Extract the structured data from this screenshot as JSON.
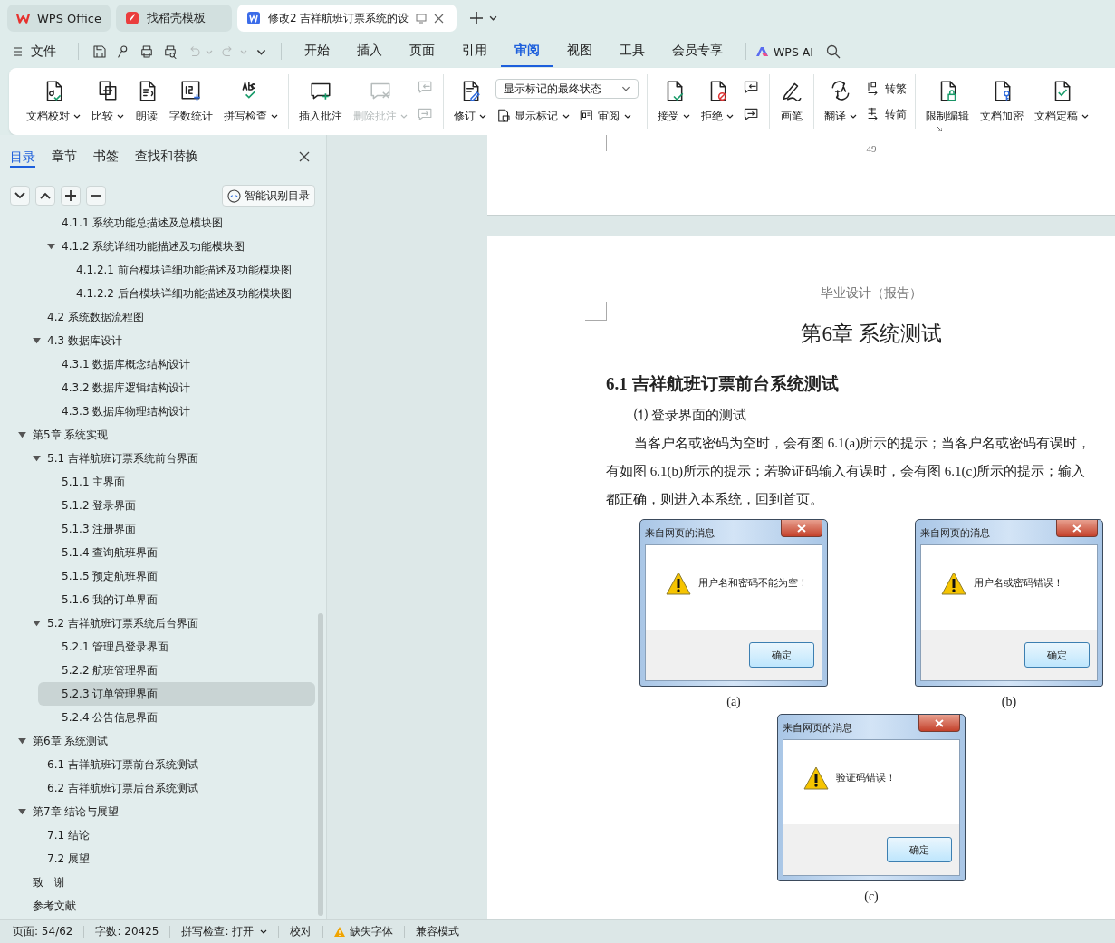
{
  "tabs": [
    {
      "label": "WPS Office",
      "selected": false
    },
    {
      "label": "找稻壳模板",
      "selected": false
    },
    {
      "label": "修改2 吉祥航班订票系统的设",
      "selected": true
    }
  ],
  "menu": {
    "file": "文件",
    "quick_access": [
      {
        "disabled": false
      },
      {
        "disabled": false
      },
      {
        "disabled": false
      },
      {
        "disabled": false
      },
      {
        "disabled": true
      },
      {
        "disabled": true
      }
    ],
    "tabs": [
      {
        "label": "开始",
        "selected": false
      },
      {
        "label": "插入",
        "selected": false
      },
      {
        "label": "页面",
        "selected": false
      },
      {
        "label": "引用",
        "selected": false
      },
      {
        "label": "审阅",
        "selected": true
      },
      {
        "label": "视图",
        "selected": false
      },
      {
        "label": "工具",
        "selected": false
      },
      {
        "label": "会员专享",
        "selected": false
      }
    ],
    "ai": "WPS AI"
  },
  "ribbon": {
    "groups": [
      {
        "items": [
          {
            "kind": "large",
            "label": "文档校对",
            "dropdown": true,
            "disabled": false
          },
          {
            "kind": "large",
            "label": "比较",
            "dropdown": true,
            "disabled": false
          },
          {
            "kind": "large",
            "label": "朗读",
            "dropdown": false,
            "disabled": false
          },
          {
            "kind": "large",
            "label": "字数统计",
            "dropdown": false,
            "disabled": false
          },
          {
            "kind": "large",
            "label": "拼写检查",
            "dropdown": true,
            "disabled": false
          }
        ]
      },
      {
        "items": [
          {
            "kind": "large",
            "label": "插入批注",
            "dropdown": false,
            "disabled": false
          },
          {
            "kind": "large",
            "label": "删除批注",
            "dropdown": true,
            "disabled": true
          },
          {
            "kind": "stack",
            "rows": [
              [
                {
                  "kind": "icon",
                  "disabled": true
                }
              ],
              [
                {
                  "kind": "icon",
                  "disabled": true
                }
              ]
            ]
          }
        ]
      },
      {
        "items": [
          {
            "kind": "large",
            "label": "修订",
            "dropdown": true,
            "disabled": false
          },
          {
            "kind": "stack",
            "rows": [
              [
                {
                  "kind": "select",
                  "value": "显示标记的最终状态"
                }
              ],
              [
                {
                  "kind": "small",
                  "label": "显示标记",
                  "dropdown": true,
                  "disabled": false
                },
                {
                  "kind": "small",
                  "label": "审阅",
                  "dropdown": true,
                  "disabled": false
                }
              ]
            ]
          }
        ]
      },
      {
        "items": [
          {
            "kind": "large",
            "label": "接受",
            "dropdown": true,
            "disabled": false
          },
          {
            "kind": "large",
            "label": "拒绝",
            "dropdown": true,
            "disabled": false
          },
          {
            "kind": "stack",
            "rows": [
              [
                {
                  "kind": "icon",
                  "disabled": false
                }
              ],
              [
                {
                  "kind": "icon",
                  "disabled": false
                }
              ]
            ]
          }
        ]
      },
      {
        "items": [
          {
            "kind": "large",
            "label": "画笔",
            "dropdown": false,
            "disabled": false
          }
        ]
      },
      {
        "items": [
          {
            "kind": "large",
            "label": "翻译",
            "dropdown": true,
            "disabled": false
          },
          {
            "kind": "stack",
            "rows": [
              [
                {
                  "kind": "small",
                  "label": "转繁",
                  "dropdown": false,
                  "disabled": false
                }
              ],
              [
                {
                  "kind": "small",
                  "label": "转简",
                  "dropdown": false,
                  "disabled": false
                }
              ]
            ]
          }
        ]
      },
      {
        "items": [
          {
            "kind": "large",
            "label": "限制编辑",
            "dropdown": false,
            "disabled": false
          },
          {
            "kind": "large",
            "label": "文档加密",
            "dropdown": false,
            "disabled": false
          },
          {
            "kind": "large",
            "label": "文档定稿",
            "dropdown": true,
            "disabled": false
          }
        ]
      }
    ]
  },
  "sidebar": {
    "tabs": [
      {
        "label": "目录",
        "selected": true
      },
      {
        "label": "章节",
        "selected": false
      },
      {
        "label": "书签",
        "selected": false
      },
      {
        "label": "查找和替换",
        "selected": false
      }
    ],
    "smart_button": "智能识别目录",
    "tree": [
      {
        "children": [
          {
            "children": [
              {
                "label": "4.1.1  系统功能总描述及总模块图",
                "selected": false
              },
              {
                "label": "4.1.2  系统详细功能描述及功能模块图",
                "selected": false,
                "expanded": true,
                "children": [
                  {
                    "label": "4.1.2.1  前台模块详细功能描述及功能模块图",
                    "selected": false
                  },
                  {
                    "label": "4.1.2.2  后台模块详细功能描述及功能模块图",
                    "selected": false
                  }
                ]
              }
            ]
          },
          {
            "label": "4.2  系统数据流程图",
            "selected": false
          },
          {
            "label": "4.3  数据库设计",
            "selected": false,
            "expanded": true,
            "children": [
              {
                "label": "4.3.1 数据库概念结构设计",
                "selected": false
              },
              {
                "label": "4.3.2  数据库逻辑结构设计",
                "selected": false
              },
              {
                "label": "4.3.3  数据库物理结构设计",
                "selected": false
              }
            ]
          }
        ]
      },
      {
        "label": "第5章  系统实现",
        "selected": false,
        "expanded": true,
        "children": [
          {
            "label": "5.1  吉祥航班订票系统前台界面",
            "selected": false,
            "expanded": true,
            "children": [
              {
                "label": "5.1.1  主界面",
                "selected": false
              },
              {
                "label": "5.1.2  登录界面",
                "selected": false
              },
              {
                "label": "5.1.3  注册界面",
                "selected": false
              },
              {
                "label": "5.1.4  查询航班界面",
                "selected": false
              },
              {
                "label": "5.1.5  预定航班界面",
                "selected": false
              },
              {
                "label": "5.1.6  我的订单界面",
                "selected": false
              }
            ]
          },
          {
            "label": "5.2  吉祥航班订票系统后台界面",
            "selected": false,
            "expanded": true,
            "children": [
              {
                "label": "5.2.1  管理员登录界面",
                "selected": false
              },
              {
                "label": "5.2.2  航班管理界面",
                "selected": false
              },
              {
                "label": "5.2.3  订单管理界面",
                "selected": true
              },
              {
                "label": "5.2.4 公告信息界面",
                "selected": false
              }
            ]
          }
        ]
      },
      {
        "label": "第6章  系统测试",
        "selected": false,
        "expanded": true,
        "children": [
          {
            "label": "6.1  吉祥航班订票前台系统测试",
            "selected": false
          },
          {
            "label": "6.2  吉祥航班订票后台系统测试",
            "selected": false
          }
        ]
      },
      {
        "label": "第7章  结论与展望",
        "selected": false,
        "expanded": true,
        "children": [
          {
            "label": "7.1  结论",
            "selected": false
          },
          {
            "label": "7.2  展望",
            "selected": false
          }
        ]
      },
      {
        "label": "致　谢",
        "selected": false
      },
      {
        "label": "参考文献",
        "selected": false
      }
    ]
  },
  "document": {
    "prev_page_number": "49",
    "header": "毕业设计（报告）",
    "chapter_title": "第6章  系统测试",
    "section_title": "6.1  吉祥航班订票前台系统测试",
    "item_title": "⑴ 登录界面的测试",
    "paragraph_lines": [
      "当客户名或密码为空时，会有图 6.1(a)所示的提示；当客户名或密码有误时，",
      "有如图 6.1(b)所示的提示；若验证码输入有误时，会有图 6.1(c)所示的提示；输入",
      "都正确，则进入本系统，回到首页。"
    ],
    "figures": [
      {
        "title": "来自网页的消息",
        "message": "用户名和密码不能为空！",
        "button": "确定",
        "caption": "(a)"
      },
      {
        "title": "来自网页的消息",
        "message": "用户名或密码错误！",
        "button": "确定",
        "caption": "(b)"
      },
      {
        "title": "来自网页的消息",
        "message": "验证码错误！",
        "button": "确定",
        "caption": "(c)"
      }
    ]
  },
  "status_bar": [
    {
      "label": "页面: 54/62",
      "dropdown": false,
      "warning": false
    },
    {
      "label": "字数: 20425",
      "dropdown": false,
      "warning": false
    },
    {
      "label": "拼写检查: 打开",
      "dropdown": true,
      "warning": false
    },
    {
      "label": "校对",
      "dropdown": false,
      "warning": false
    },
    {
      "label": "缺失字体",
      "dropdown": false,
      "warning": true
    },
    {
      "label": "兼容模式",
      "dropdown": false,
      "warning": false
    }
  ]
}
